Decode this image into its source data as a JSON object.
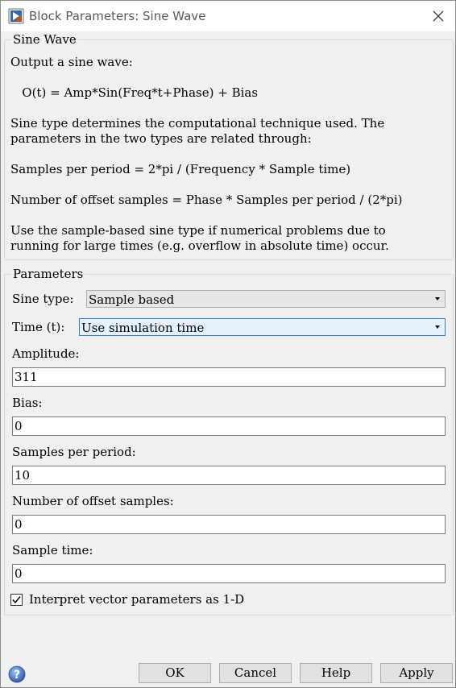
{
  "window": {
    "title": "Block Parameters: Sine Wave"
  },
  "description": {
    "group_title": "Sine Wave",
    "lines": [
      "Output a sine wave:",
      "   O(t) = Amp*Sin(Freq*t+Phase) + Bias",
      "Sine type determines the computational technique used. The",
      "parameters in the two types are related through:",
      "Samples per period = 2*pi / (Frequency * Sample time)",
      "Number of offset samples = Phase * Samples per period / (2*pi)",
      "Use the sample-based sine type if numerical problems due to",
      "running for large times (e.g. overflow in absolute time) occur."
    ]
  },
  "parameters": {
    "group_title": "Parameters",
    "sine_type": {
      "label": "Sine type:",
      "value": "Sample based"
    },
    "time": {
      "label": "Time (t):",
      "value": "Use simulation time"
    },
    "amplitude": {
      "label": "Amplitude:",
      "value": "311"
    },
    "bias": {
      "label": "Bias:",
      "value": "0"
    },
    "samples_per_period": {
      "label": "Samples per period:",
      "value": "10"
    },
    "offset_samples": {
      "label": "Number of offset samples:",
      "value": "0"
    },
    "sample_time": {
      "label": "Sample time:",
      "value": "0"
    },
    "interpret_vector": {
      "label": "Interpret vector parameters as 1-D",
      "checked": true
    }
  },
  "buttons": {
    "ok": "OK",
    "cancel": "Cancel",
    "help": "Help",
    "apply": "Apply"
  },
  "colors": {
    "focus_border": "#2f7fd1",
    "help_icon": "#3a6fc4"
  },
  "icons": [
    "simulink-block-icon",
    "close-icon",
    "chevron-down-icon",
    "checkmark-icon",
    "help-icon"
  ]
}
